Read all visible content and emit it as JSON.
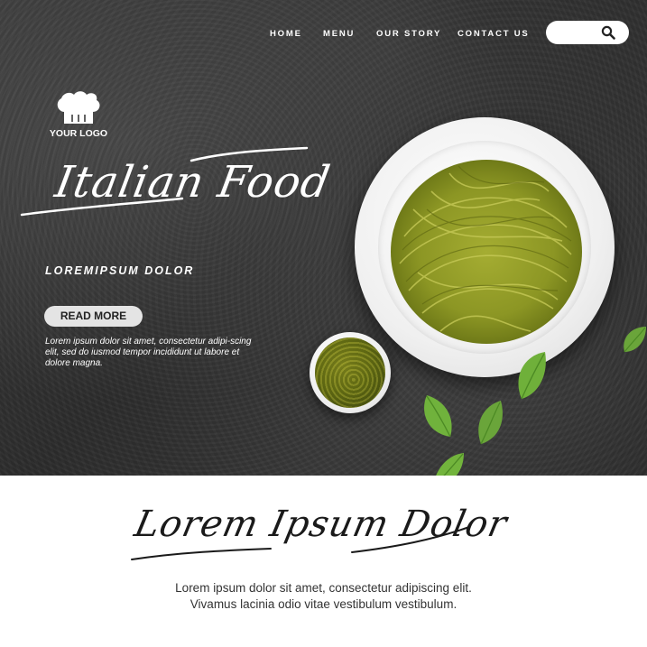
{
  "nav": {
    "items": [
      "HOME",
      "MENU",
      "OUR STORY",
      "CONTACT US"
    ],
    "search": {
      "value": "",
      "icon": "search-icon"
    }
  },
  "logo": {
    "text": "YOUR LOGO",
    "icon": "chef-hat-icon"
  },
  "hero": {
    "script_title": "Italian Food",
    "subtitle": "LOREMIPSUM DOLOR",
    "button_label": "READ MORE",
    "description": "Lorem ipsum dolor sit amet, consectetur adipi-scing elit, sed do iusmod tempor incididunt ut labore et dolore magna."
  },
  "section": {
    "script_title": "Lorem Ipsum Dolor",
    "lines": [
      "Lorem ipsum dolor sit amet, consectetur adipiscing elit.",
      "Vivamus lacinia odio vitae vestibulum vestibulum."
    ]
  },
  "colors": {
    "hero_background": "#2f2f2f",
    "text_light": "#ffffff",
    "button_bg": "#e4e4e4",
    "basil_green": "#6aa53a",
    "pasta_green": "#9aa32a"
  }
}
